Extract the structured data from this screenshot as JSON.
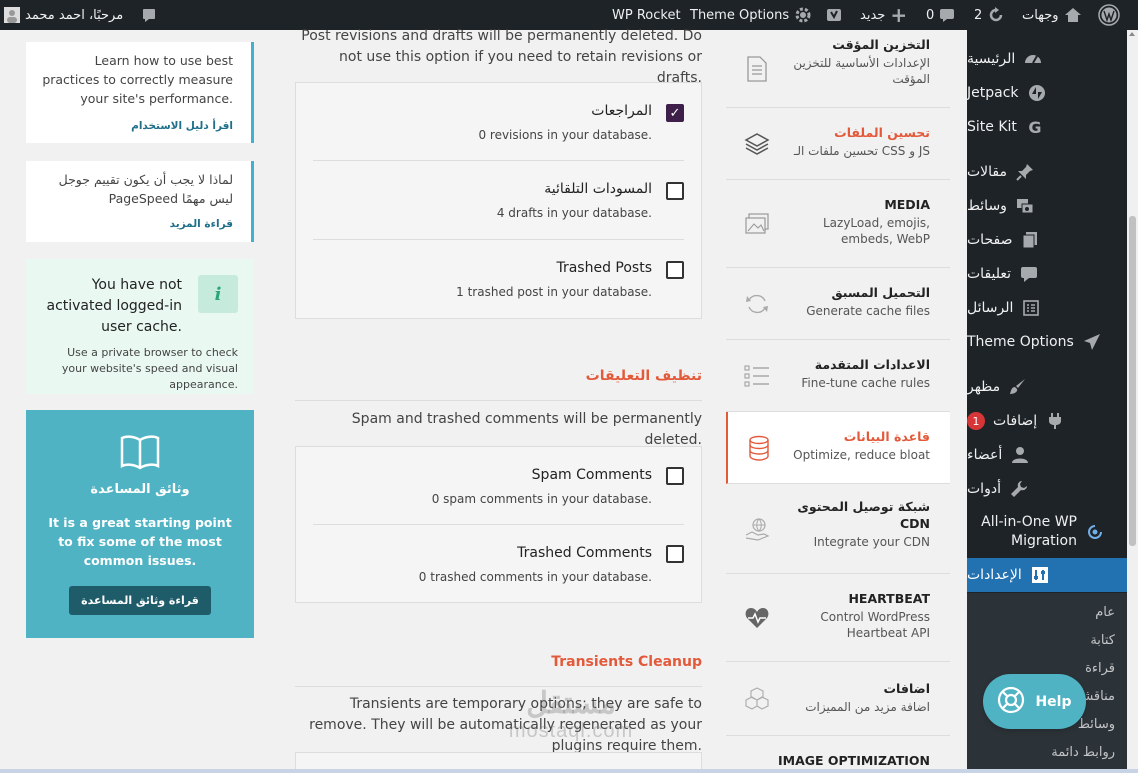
{
  "adminbar": {
    "greeting": "مرحبًا، احمد محمد",
    "updates_count": "2",
    "comments_count": "0",
    "new_label": "جديد",
    "site_name": "وجهات",
    "theme_options": "Theme Options",
    "wp_rocket": "WP Rocket"
  },
  "admin_menu": {
    "items": [
      {
        "label": "الرئيسية",
        "icon": "dashboard-icon"
      },
      {
        "label": "Jetpack",
        "icon": "jetpack-icon"
      },
      {
        "label": "Site Kit",
        "icon": "google-icon"
      },
      {
        "label": "مقالات",
        "icon": "pin-icon"
      },
      {
        "label": "وسائط",
        "icon": "media-icon"
      },
      {
        "label": "صفحات",
        "icon": "pages-icon"
      },
      {
        "label": "تعليقات",
        "icon": "comments-icon"
      },
      {
        "label": "الرسائل",
        "icon": "messages-icon"
      },
      {
        "label": "Theme Options",
        "icon": "plane-icon"
      },
      {
        "label": "مظهر",
        "icon": "brush-icon"
      },
      {
        "label": "إضافات",
        "icon": "plugin-icon",
        "badge": "1"
      },
      {
        "label": "أعضاء",
        "icon": "user-icon"
      },
      {
        "label": "أدوات",
        "icon": "wrench-icon"
      },
      {
        "label": "All-in-One WP Migration",
        "icon": "migration-icon"
      },
      {
        "label": "الإعدادات",
        "icon": "settings-icon",
        "current": true
      }
    ],
    "submenu": [
      "عام",
      "كتابة",
      "قراءة",
      "مناقشة",
      "وسائط",
      "روابط دائمة"
    ]
  },
  "rocket_nav": [
    {
      "title": "التخزين المؤقت",
      "sub": "الإعدادات الأساسية للتخزين المؤقت",
      "icon": "document-icon"
    },
    {
      "title": "تحسين الملفات",
      "sub": "تحسين ملفات الـ CSS و JS",
      "icon": "layers-icon",
      "highlight": true
    },
    {
      "title": "MEDIA",
      "sub": "LazyLoad, emojis, embeds, WebP",
      "icon": "images-icon"
    },
    {
      "title": "التحميل المسبق",
      "sub": "Generate cache files",
      "icon": "refresh-icon"
    },
    {
      "title": "الاعدادات المتقدمة",
      "sub": "Fine-tune cache rules",
      "icon": "list-icon"
    },
    {
      "title": "قاعدة البيانات",
      "sub": "Optimize, reduce bloat",
      "icon": "database-icon",
      "active": true
    },
    {
      "title": "شبكة توصيل المحتوى CDN",
      "sub": "Integrate your CDN",
      "icon": "cdn-icon"
    },
    {
      "title": "HEARTBEAT",
      "sub": "Control WordPress Heartbeat API",
      "icon": "heartbeat-icon"
    },
    {
      "title": "اضافات",
      "sub": "اضافة مزيد من المميزات",
      "icon": "cubes-icon"
    },
    {
      "title": "IMAGE OPTIMIZATION",
      "sub": "",
      "icon": ""
    }
  ],
  "main": {
    "posts_intro": "Post revisions and drafts will be permanently deleted. Do not use this option if you need to retain revisions or drafts.",
    "posts_rows": [
      {
        "label": "المراجعات",
        "desc": "0 revisions in your database.",
        "checked": true
      },
      {
        "label": "المسودات التلقائية",
        "desc": "4 drafts in your database.",
        "checked": false
      },
      {
        "label": "Trashed Posts",
        "desc": "1 trashed post in your database.",
        "checked": false
      }
    ],
    "comments_title": "تنظيف التعليقات",
    "comments_intro": "Spam and trashed comments will be permanently deleted.",
    "comments_rows": [
      {
        "label": "Spam Comments",
        "desc": "0 spam comments in your database.",
        "checked": false
      },
      {
        "label": "Trashed Comments",
        "desc": "0 trashed comments in your database.",
        "checked": false
      }
    ],
    "transients_title": "Transients Cleanup",
    "transients_intro": "Transients are temporary options; they are safe to remove. They will be automatically regenerated as your plugins require them."
  },
  "sidebar": {
    "card1_text": "Learn how to use best practices to correctly measure your site's performance.",
    "card1_link": "اقرأ دليل الاستخدام",
    "card2_text": "لماذا لا يجب أن يكون تقييم جوجل PageSpeed ليس مهمًا",
    "card2_link": "قراءة المزيد",
    "notice_title": "You have not activated logged-in user cache.",
    "notice_text": "Use a private browser to check your website's speed and visual appearance.",
    "help_title": "وثائق المساعدة",
    "help_text": "It is a great starting point to fix some of the most common issues.",
    "help_button": "قراءة وثائق المساعدة"
  },
  "help_widget": {
    "label": "Help"
  },
  "watermark": {
    "brand": "مستقل",
    "domain": "mostaql.com"
  },
  "colors": {
    "accent": "#e35a3b",
    "admin_dark": "#1d2327",
    "wp_blue": "#2271b1",
    "help_teal": "#4fb3c4"
  }
}
